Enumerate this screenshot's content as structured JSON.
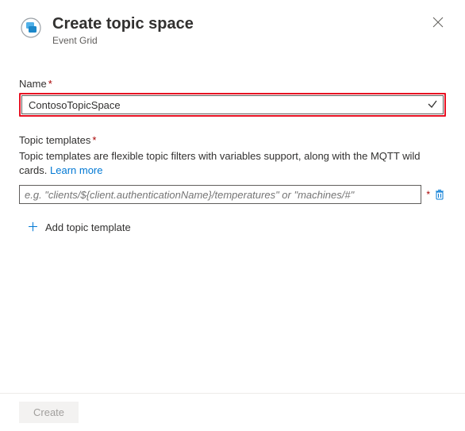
{
  "header": {
    "title": "Create topic space",
    "subtitle": "Event Grid"
  },
  "name_field": {
    "label": "Name",
    "value": "ContosoTopicSpace"
  },
  "templates": {
    "label": "Topic templates",
    "description": "Topic templates are flexible topic filters with variables support, along with the MQTT wild cards. ",
    "learn_more": "Learn more",
    "placeholder": "e.g. \"clients/${client.authenticationName}/temperatures\" or \"machines/#\"",
    "add_label": "Add topic template"
  },
  "footer": {
    "create": "Create"
  }
}
